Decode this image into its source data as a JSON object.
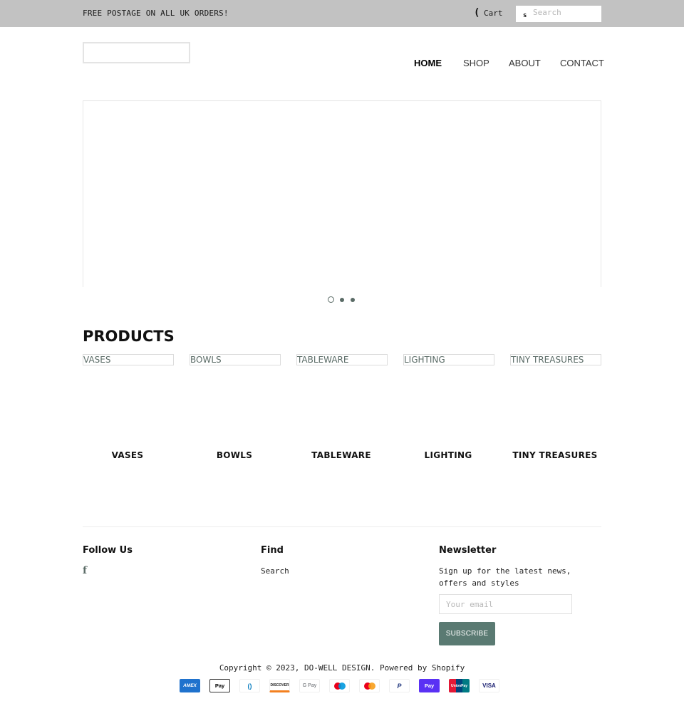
{
  "announcement": {
    "text": "FREE POSTAGE ON ALL UK ORDERS!",
    "cart_icon": "cart-icon",
    "cart_icon_glyph": "(",
    "cart_label": "Cart",
    "search_icon_glyph": "s",
    "search_placeholder": "Search"
  },
  "nav": {
    "items": [
      {
        "label": "HOME",
        "active": true
      },
      {
        "label": "SHOP",
        "active": false
      },
      {
        "label": "ABOUT",
        "active": false
      },
      {
        "label": "CONTACT",
        "active": false
      }
    ]
  },
  "slideshow": {
    "slide_count": 3,
    "active_slide": 1
  },
  "products": {
    "title": "PRODUCTS",
    "categories": [
      {
        "image_alt": "VASES",
        "title": "VASES"
      },
      {
        "image_alt": "BOWLS",
        "title": "BOWLS"
      },
      {
        "image_alt": "TABLEWARE",
        "title": "TABLEWARE"
      },
      {
        "image_alt": "LIGHTING",
        "title": "LIGHTING"
      },
      {
        "image_alt": "TINY TREASURES",
        "title": "TINY TREASURES"
      }
    ]
  },
  "footer": {
    "follow_heading": "Follow Us",
    "facebook_glyph": "f",
    "find_heading": "Find",
    "find_links": [
      "Search"
    ],
    "newsletter_heading": "Newsletter",
    "newsletter_text": "Sign up for the latest news, offers and styles",
    "email_placeholder": "Your email",
    "subscribe_label": "SUBSCRIBE",
    "copyright": "Copyright © 2023, DO-WELL DESIGN. Powered by Shopify",
    "payment_methods": [
      {
        "name": "American Express",
        "label": "AMEX"
      },
      {
        "name": "Apple Pay",
        "label": " Pay"
      },
      {
        "name": "Diners Club",
        "label": "()"
      },
      {
        "name": "Discover",
        "label": "DISCOVER"
      },
      {
        "name": "Google Pay",
        "label": "G Pay"
      },
      {
        "name": "Maestro",
        "label": ""
      },
      {
        "name": "Mastercard",
        "label": ""
      },
      {
        "name": "PayPal",
        "label": "P"
      },
      {
        "name": "Shop Pay",
        "label": "Pay"
      },
      {
        "name": "UnionPay",
        "label": "UnionPay"
      },
      {
        "name": "Visa",
        "label": "VISA"
      }
    ]
  },
  "colors": {
    "announcement_bg": "#c2c2c2",
    "accent": "#5a7a72",
    "category_text": "#5a6b66"
  }
}
